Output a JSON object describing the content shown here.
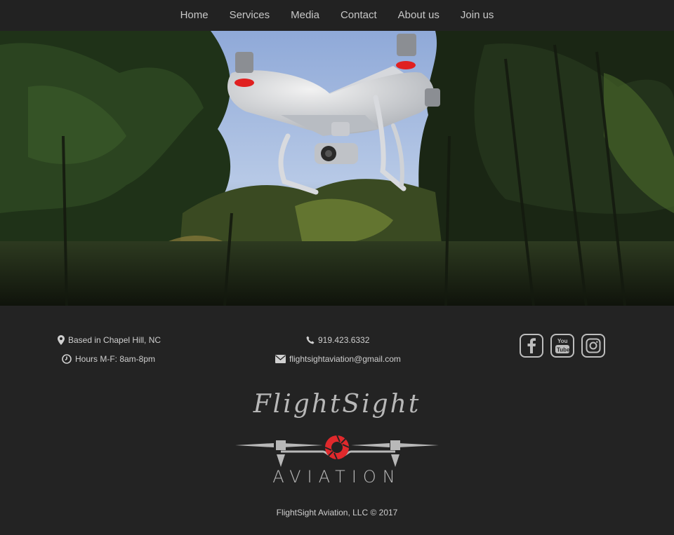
{
  "nav": {
    "items": [
      "Home",
      "Services",
      "Media",
      "Contact",
      "About us",
      "Join us"
    ]
  },
  "hero": {
    "image": "drone-over-forest"
  },
  "footer": {
    "location": "Based in Chapel Hill, NC",
    "hours": "Hours M-F: 8am-8pm",
    "phone": "919.423.6332",
    "email": "flightsightaviation@gmail.com",
    "social": [
      "facebook-icon",
      "youtube-icon",
      "instagram-icon"
    ],
    "logo": {
      "script": "FlightSight",
      "word": "AVIATION",
      "accent": "#e0292c"
    },
    "copyright": "FlightSight Aviation, LLC © 2017"
  },
  "colors": {
    "background": "#232323",
    "text": "#c8c8c8"
  }
}
